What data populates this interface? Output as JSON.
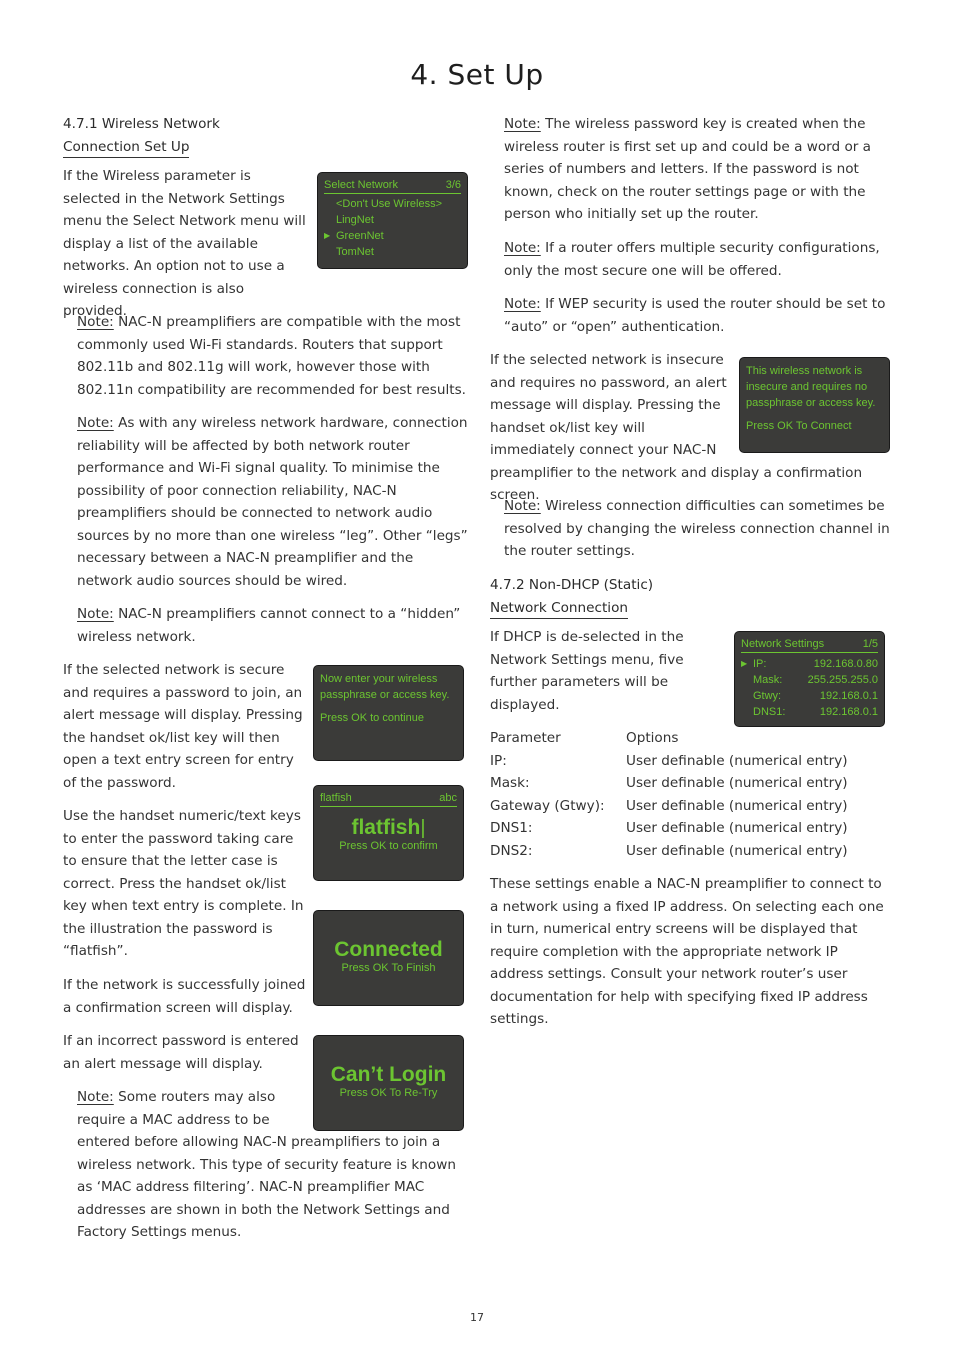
{
  "page": {
    "title": "4. Set Up",
    "page_number": "17"
  },
  "section_471": {
    "heading_line1": "4.7.1 Wireless Network",
    "heading_line2": "Connection Set Up",
    "intro": "If the Wireless parameter is selected in the Network Settings menu the Select Network menu will display a list of the available networks. An option not to use a wireless connection is also provided.",
    "notes": [
      {
        "label": "Note:",
        "text": " NAC-N preamplifiers are compatible with the most commonly used Wi-Fi standards. Routers that support 802.11b and 802.11g will work, however those with 802.11n compatibility are recommended for best results."
      },
      {
        "label": "Note:",
        "text": " As with any wireless network hardware, connection reliability will be affected by both network router performance and Wi-Fi signal quality. To minimise the possibility of poor connection reliability, NAC-N preamplifiers should be connected to network audio sources by no more than one wireless “leg”. Other “legs” necessary between a NAC-N preamplifier and the network audio sources should be wired."
      },
      {
        "label": "Note:",
        "text": " NAC-N preamplifiers cannot connect to a “hidden” wireless network."
      }
    ],
    "secure_text": "If the selected network is secure and requires a password to join, an alert message will display. Pressing the handset ok/list key will then open a text entry screen for entry of the password.",
    "keys_text": "Use the handset numeric/text keys to enter the password taking care to ensure that the letter case is correct. Press the handset ok/list key when text entry is complete. In the illustration the password is “flatfish”.",
    "joined_text": "If the network is successfully joined a confirmation screen will display.",
    "incorrect_text": "If an incorrect password is entered an alert message will display.",
    "mac_note": {
      "label": "Note:",
      "text": " Some routers may also require a MAC address to be entered before allowing NAC-N preamplifiers to join a wireless network. This type of security feature is known as ‘MAC address filtering’. NAC-N preamplifier MAC addresses are shown in both the Network Settings and Factory Settings menus."
    }
  },
  "right_notes": [
    {
      "label": "Note:",
      "text": " The wireless password key is created when the wireless router is first set up and could be a word or a series of numbers and letters. If the password is not known, check on the router settings page or with the person who initially set up the router."
    },
    {
      "label": "Note:",
      "text": " If a router offers multiple security configurations, only the most secure one will be offered."
    },
    {
      "label": "Note:",
      "text": " If WEP security is used the router should be set to “auto” or “open” authentication."
    }
  ],
  "insecure_text": "If the selected network is insecure and requires no password, an alert message will display. Pressing the handset ok/list key will immediately connect your NAC-N preamplifier to the network and display a confirmation screen.",
  "channel_note": {
    "label": "Note:",
    "text": " Wireless connection difficulties can sometimes be resolved by changing the wireless connection channel in the router settings."
  },
  "section_472": {
    "heading_line1": "4.7.2 Non-DHCP (Static)",
    "heading_line2": "Network Connection",
    "intro": "If DHCP is de-selected in the Network Settings menu, five further parameters will be displayed.",
    "table": {
      "headers": [
        "Parameter",
        "Options"
      ],
      "rows": [
        [
          "IP:",
          "User definable (numerical entry)"
        ],
        [
          "Mask:",
          "User definable (numerical entry)"
        ],
        [
          "Gateway (Gtwy):",
          "User definable (numerical entry)"
        ],
        [
          "DNS1:",
          "User definable (numerical entry)"
        ],
        [
          "DNS2:",
          "User definable (numerical entry)"
        ]
      ]
    },
    "closing": "These settings enable a NAC-N preamplifier to connect to a network using a fixed IP address. On selecting each one in turn, numerical entry screens will be displayed that require completion with the appropriate network IP address settings. Consult your network router’s user documentation for help with specifying fixed IP address settings."
  },
  "screens": {
    "select_network": {
      "title": "Select Network",
      "counter": "3/6",
      "items": [
        "<Don't Use Wireless>",
        "LingNet",
        "GreenNet",
        "TomNet"
      ],
      "selected_index": 2,
      "arrow": "▶"
    },
    "enter_passphrase": {
      "line1": "Now enter your wireless passphrase or access key.",
      "line2": "Press OK to continue"
    },
    "text_entry": {
      "title": "flatfish",
      "mode": "abc",
      "value": "flatfish",
      "hint": "Press OK to confirm"
    },
    "connected": {
      "big": "Connected",
      "hint": "Press OK To Finish"
    },
    "cant_login": {
      "big": "Can’t Login",
      "hint": "Press OK To Re-Try"
    },
    "insecure": {
      "line1": "This wireless network is insecure and requires no passphrase or access key.",
      "line2": "Press OK To Connect"
    },
    "network_settings": {
      "title": "Network Settings",
      "counter": "1/5",
      "arrow": "▶",
      "rows": [
        {
          "key": "IP:",
          "value": "192.168.0.80"
        },
        {
          "key": "Mask:",
          "value": "255.255.255.0"
        },
        {
          "key": "Gtwy:",
          "value": "192.168.0.1"
        },
        {
          "key": "DNS1:",
          "value": "192.168.0.1"
        }
      ]
    }
  },
  "colors": {
    "screen_bg": "#3b3b39",
    "screen_text": "#6cc531",
    "body_text": "#333333"
  }
}
